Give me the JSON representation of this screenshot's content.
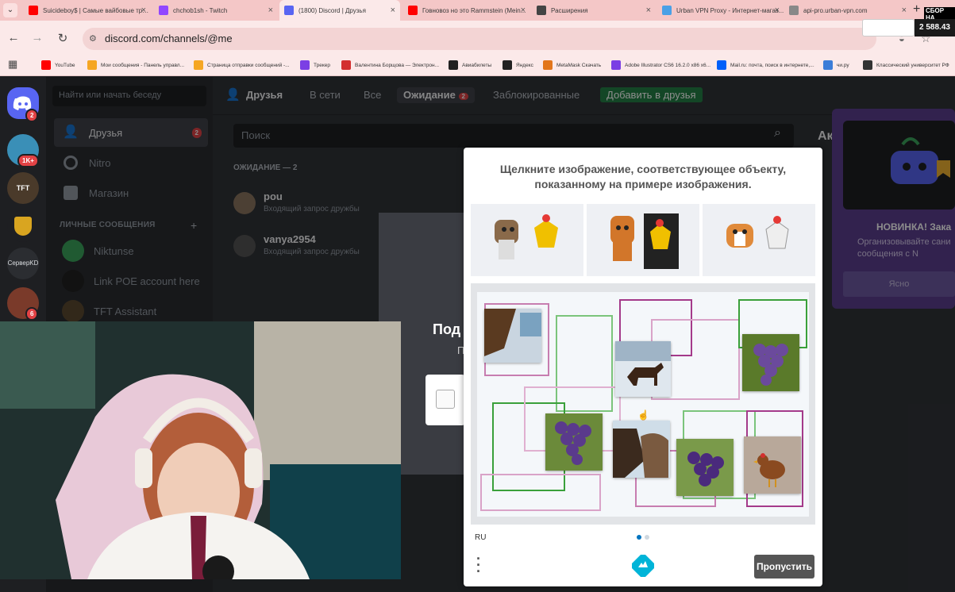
{
  "browser": {
    "tabs": [
      {
        "title": "Suicideboy$ | Самые вайбовые тре...",
        "favicon_color": "#ff0000",
        "active": false
      },
      {
        "title": "chchob1sh - Twitch",
        "favicon_color": "#9146ff",
        "active": false
      },
      {
        "title": "(1800) Discord | Друзья",
        "favicon_color": "#5865f2",
        "active": true
      },
      {
        "title": "Говновоз но это Rammstein (Mein...",
        "favicon_color": "#ff0000",
        "active": false
      },
      {
        "title": "Расширения",
        "favicon_color": "#444444",
        "active": false
      },
      {
        "title": "Urban VPN Proxy - Интернет-магаз...",
        "favicon_color": "#4aa0e6",
        "active": false
      },
      {
        "title": "api-pro.urban-vpn.com",
        "favicon_color": "#888888",
        "active": false
      }
    ],
    "url": "discord.com/channels/@me",
    "bookmarks": [
      {
        "label": "YouTube",
        "color": "#ff0000"
      },
      {
        "label": "Мои сообщения - Панель управл...",
        "color": "#f5a623"
      },
      {
        "label": "Страница отправки сообщений -...",
        "color": "#f5a623"
      },
      {
        "label": "Трекер",
        "color": "#7b3fe4"
      },
      {
        "label": "Валентина Борщова — Электрон...",
        "color": "#d32f2f"
      },
      {
        "label": "Авиабилеты",
        "color": "#222222"
      },
      {
        "label": "Яндекс",
        "color": "#222222"
      },
      {
        "label": "MetaMask Скачать",
        "color": "#e2761b"
      },
      {
        "label": "Adobe Illustrator CS6 16.2.0 x86 x6...",
        "color": "#7b3fe4"
      },
      {
        "label": "Mail.ru: почта, поиск в интернете,...",
        "color": "#005ff9"
      },
      {
        "label": "чи.ру",
        "color": "#3b7dd8"
      },
      {
        "label": "Классический университет РФ",
        "color": "#333333"
      }
    ]
  },
  "overlay": {
    "title": "СБОР НА",
    "count": "2 588.43"
  },
  "discord": {
    "guild_badges": [
      "2",
      "1K+",
      "6"
    ],
    "guild_labels": [
      "TFT",
      "СерверKD"
    ],
    "search_placeholder": "Найти или начать беседу",
    "nav": [
      {
        "label": "Друзья",
        "badge": "2"
      },
      {
        "label": "Nitro"
      },
      {
        "label": "Магазин"
      }
    ],
    "dm_header": "ЛИЧНЫЕ СООБЩЕНИЯ",
    "dms": [
      "Niktunse",
      "Link POE account here",
      "TFT Assistant"
    ],
    "tabs": {
      "title": "Друзья",
      "online": "В сети",
      "all": "Все",
      "pending": "Ожидание",
      "pending_badge": "2",
      "blocked": "Заблокированные",
      "add": "Добавить в друзья"
    },
    "main_search_placeholder": "Поиск",
    "pending_label": "ОЖИДАНИЕ — 2",
    "requests": [
      {
        "name": "pou",
        "status": "Входящий запрос дружбы"
      },
      {
        "name": "vanya2954",
        "status": "Входящий запрос дружбы"
      }
    ],
    "right": {
      "heading_partial": "Ак",
      "new_title": "НОВИНКА! Зака",
      "desc": "Организовывайте сани сообщения с N",
      "button": "Ясно"
    },
    "modal": {
      "title": "Под",
      "sub": "П"
    }
  },
  "captcha": {
    "prompt": "Щелкните изображение, соответствующее объекту, показанному на примере изображения.",
    "language": "RU",
    "skip": "Пропустить"
  }
}
